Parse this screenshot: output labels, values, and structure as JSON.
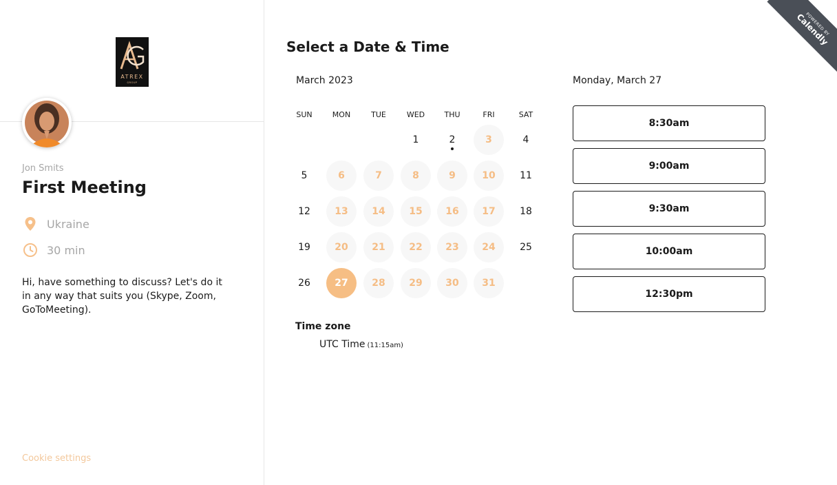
{
  "profile": {
    "logo_text": "ATREX",
    "logo_sub": "GROUP",
    "owner_name": "Jon Smits",
    "event_title": "First Meeting",
    "location": "Ukraine",
    "duration": "30 min",
    "description": "Hi, have something to discuss? Let's do it in any way that suits you (Skype, Zoom, GoToMeeting).",
    "cookie_settings": "Cookie settings"
  },
  "booking": {
    "heading": "Select a Date & Time",
    "month_label": "March 2023",
    "weekdays": [
      "SUN",
      "MON",
      "TUE",
      "WED",
      "THU",
      "FRI",
      "SAT"
    ],
    "days": [
      {
        "day": "1",
        "state": "unavailable"
      },
      {
        "day": "2",
        "state": "unavailable",
        "today": true
      },
      {
        "day": "3",
        "state": "available"
      },
      {
        "day": "4",
        "state": "unavailable"
      },
      {
        "day": "5",
        "state": "unavailable"
      },
      {
        "day": "6",
        "state": "available"
      },
      {
        "day": "7",
        "state": "available"
      },
      {
        "day": "8",
        "state": "available"
      },
      {
        "day": "9",
        "state": "available"
      },
      {
        "day": "10",
        "state": "available"
      },
      {
        "day": "11",
        "state": "unavailable"
      },
      {
        "day": "12",
        "state": "unavailable"
      },
      {
        "day": "13",
        "state": "available"
      },
      {
        "day": "14",
        "state": "available"
      },
      {
        "day": "15",
        "state": "available"
      },
      {
        "day": "16",
        "state": "available"
      },
      {
        "day": "17",
        "state": "available"
      },
      {
        "day": "18",
        "state": "unavailable"
      },
      {
        "day": "19",
        "state": "unavailable"
      },
      {
        "day": "20",
        "state": "available"
      },
      {
        "day": "21",
        "state": "available"
      },
      {
        "day": "22",
        "state": "available"
      },
      {
        "day": "23",
        "state": "available"
      },
      {
        "day": "24",
        "state": "available"
      },
      {
        "day": "25",
        "state": "unavailable"
      },
      {
        "day": "26",
        "state": "unavailable"
      },
      {
        "day": "27",
        "state": "selected"
      },
      {
        "day": "28",
        "state": "available"
      },
      {
        "day": "29",
        "state": "available"
      },
      {
        "day": "30",
        "state": "available"
      },
      {
        "day": "31",
        "state": "available"
      }
    ],
    "timezone_label": "Time zone",
    "timezone_value": "UTC Time",
    "timezone_time": "(11:15am)",
    "selected_date": "Monday, March 27",
    "slots": [
      "8:30am",
      "9:00am",
      "9:30am",
      "10:00am",
      "12:30pm"
    ]
  },
  "badge": {
    "powered_by": "POWERED BY",
    "brand": "Calendly"
  },
  "colors": {
    "accent": "#f6be84",
    "available_text": "#f5bd85",
    "available_bg": "#f7f7f7",
    "muted_text": "#a6a6a6",
    "badge_bg": "#4a4f57"
  },
  "icons": {
    "location": "location-pin-icon",
    "duration": "clock-icon"
  }
}
